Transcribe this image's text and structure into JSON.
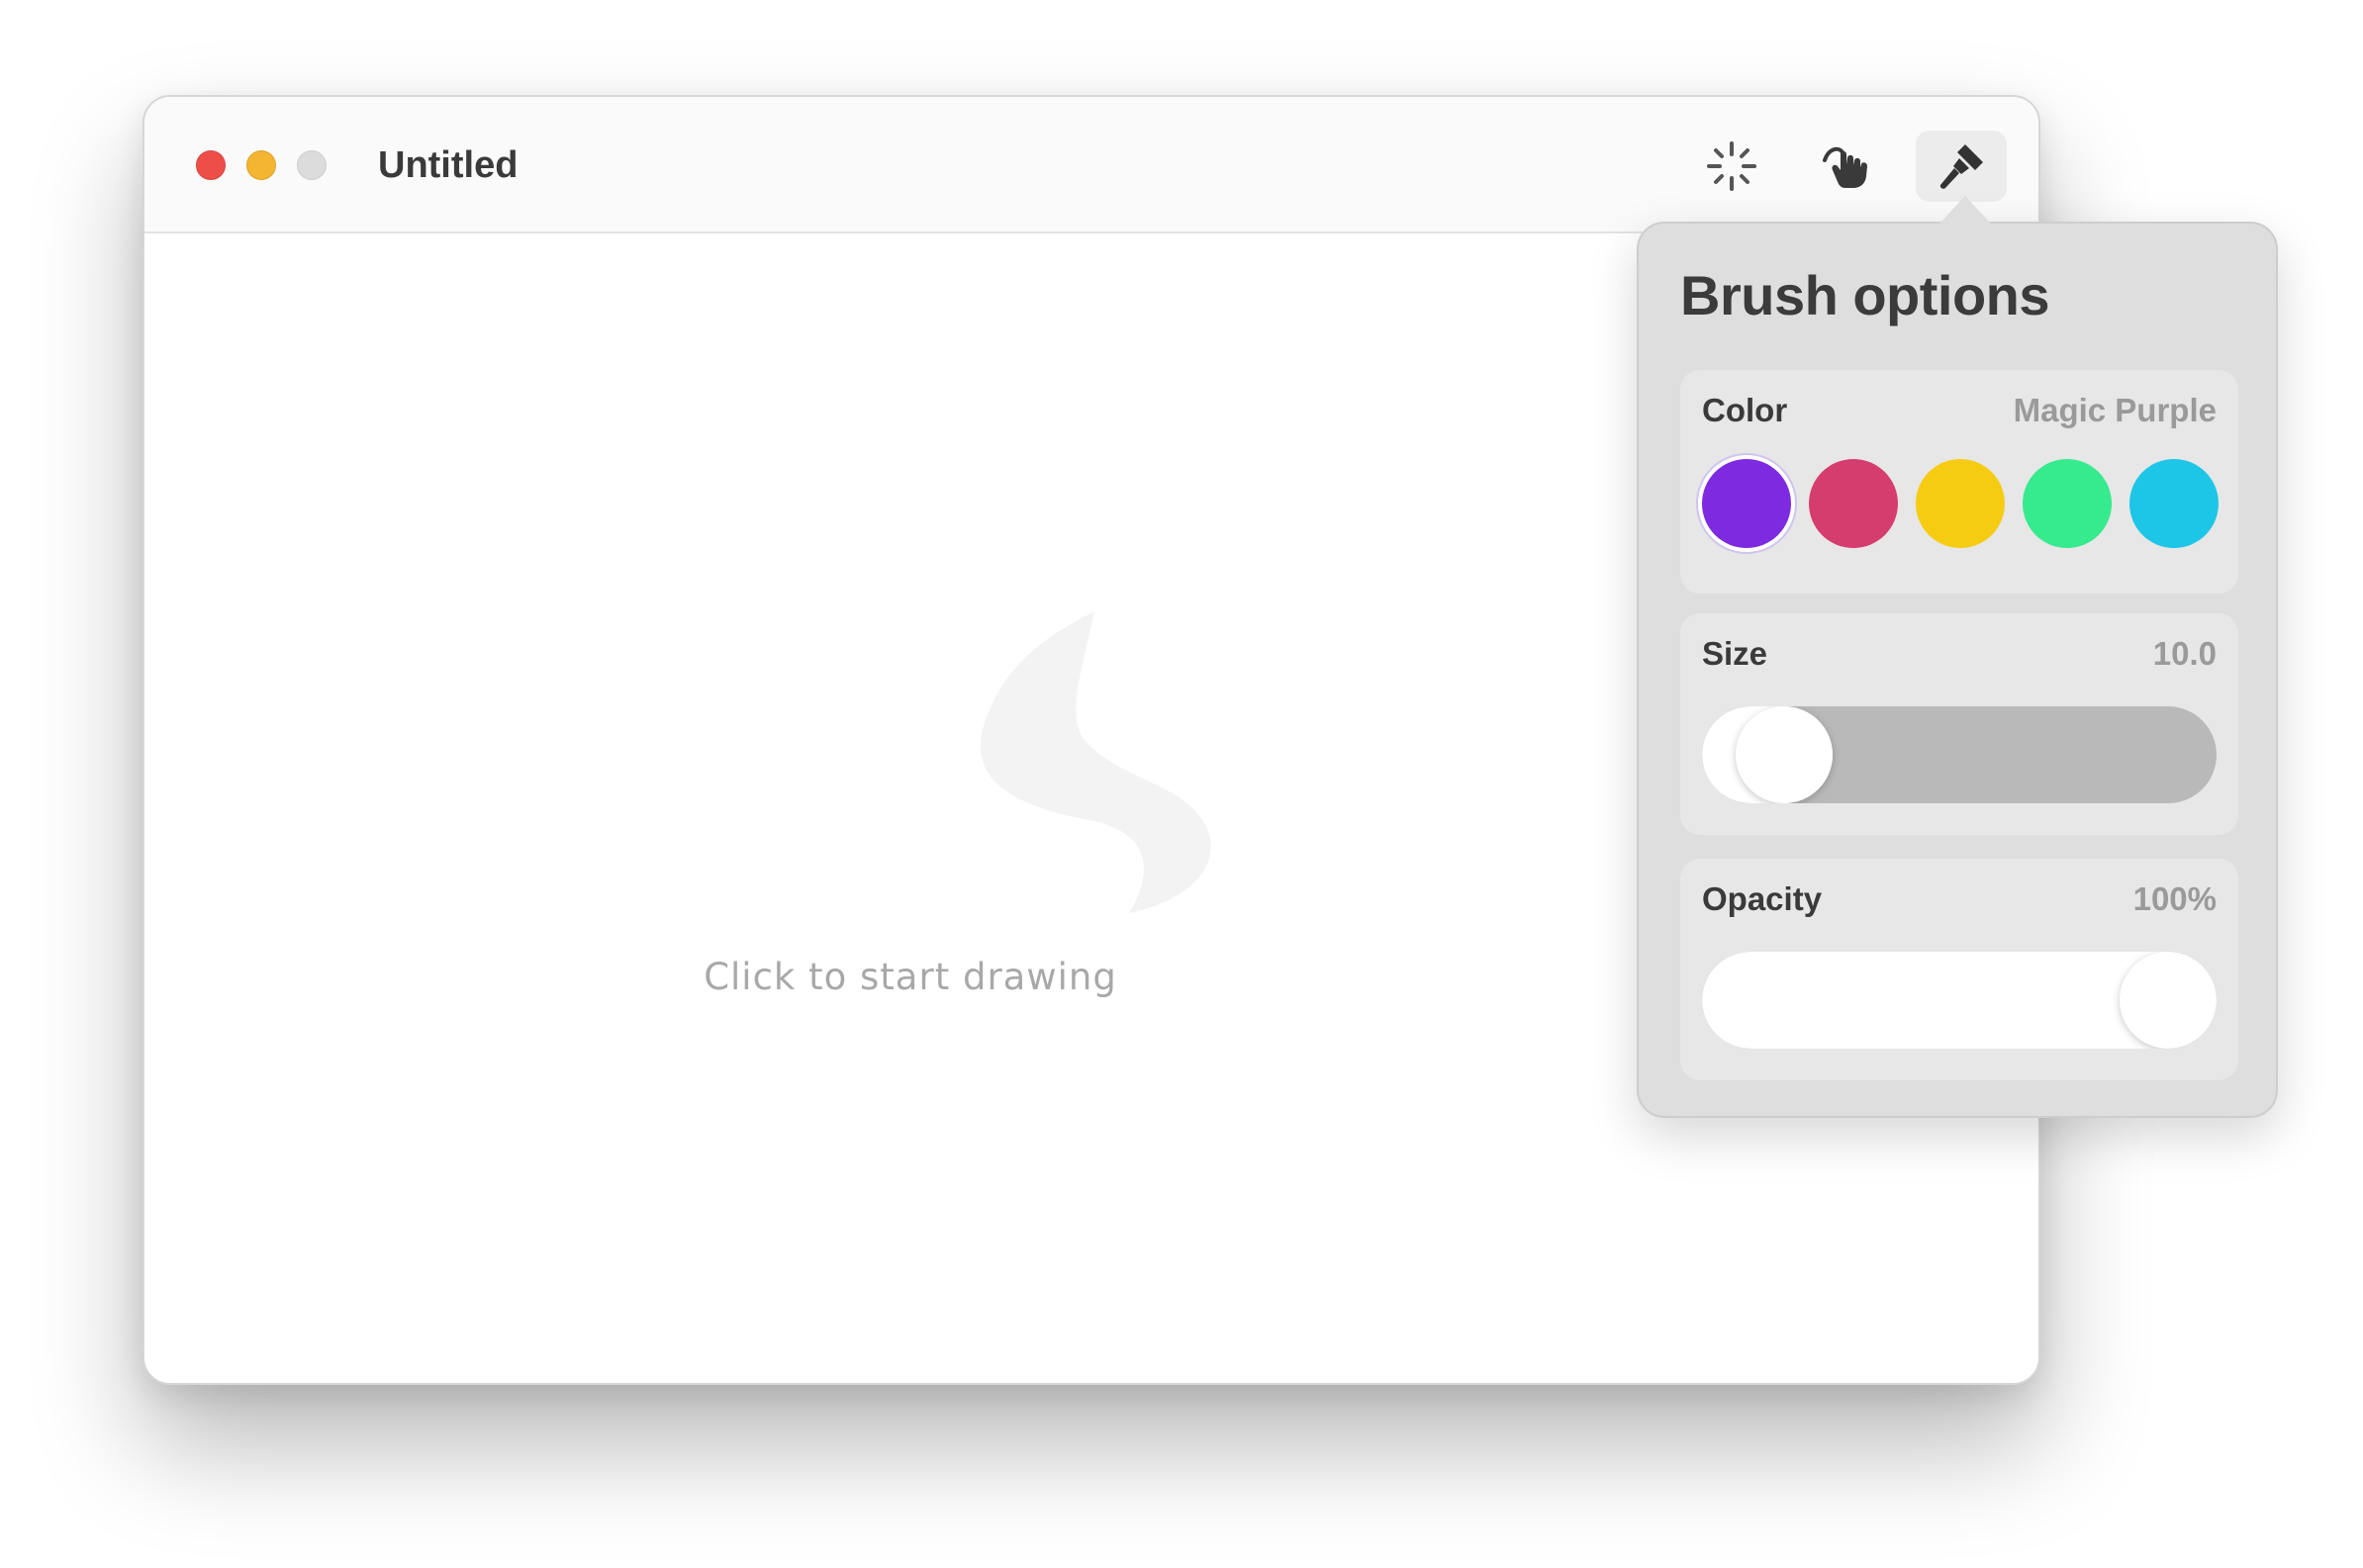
{
  "window": {
    "title": "Untitled"
  },
  "toolbar": {
    "tools": [
      {
        "icon": "sparkle-icon",
        "active": false
      },
      {
        "icon": "hand-pointer-icon",
        "active": false
      },
      {
        "icon": "brush-icon",
        "active": true
      }
    ]
  },
  "canvas": {
    "placeholder_icon": "squiggle-icon",
    "placeholder_text": "Click to start drawing"
  },
  "brush_options": {
    "title": "Brush options",
    "color": {
      "label": "Color",
      "selected_name": "Magic Purple",
      "swatches": [
        {
          "name": "Magic Purple",
          "hex": "#7d2ae0",
          "selected": true
        },
        {
          "name": "pink",
          "hex": "#d63d6f",
          "selected": false
        },
        {
          "name": "yellow",
          "hex": "#f5cc12",
          "selected": false
        },
        {
          "name": "green",
          "hex": "#36ea8e",
          "selected": false
        },
        {
          "name": "cyan",
          "hex": "#1dc6e6",
          "selected": false
        }
      ]
    },
    "size": {
      "label": "Size",
      "value_text": "10.0",
      "fraction": 0.08
    },
    "opacity": {
      "label": "Opacity",
      "value_text": "100%",
      "fraction": 1.0
    }
  }
}
